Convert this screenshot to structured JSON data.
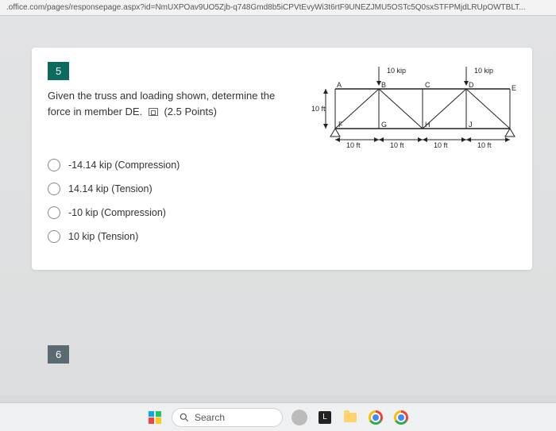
{
  "url": ".office.com/pages/responsepage.aspx?id=NmUXPOav9UO5Zjb-q748Gmd8b5iCPVtEvyWi3t6rtF9UNEZJMU5OSTc5Q0sxSTFPMjdLRUpOWTBLT...",
  "question": {
    "number": "5",
    "text_line1": "Given the truss and loading shown, determine the",
    "text_line2_prefix": "force in member DE.",
    "points": "(2.5 Points)"
  },
  "diagram": {
    "load_left": "10 kip",
    "load_right": "10 kip",
    "nodes": {
      "A": "A",
      "B": "B",
      "C": "C",
      "D": "D",
      "E": "E",
      "F": "F",
      "G": "G",
      "H": "H",
      "J": "J"
    },
    "v_dim": "10 ft",
    "h_dims": [
      "10 ft",
      "10 ft",
      "10 ft",
      "10 ft"
    ]
  },
  "options": [
    "-14.14 kip (Compression)",
    "14.14 kip (Tension)",
    "-10 kip (Compression)",
    "10 kip (Tension)"
  ],
  "next_number": "6",
  "taskbar": {
    "search_placeholder": "Search",
    "l_label": "L"
  }
}
